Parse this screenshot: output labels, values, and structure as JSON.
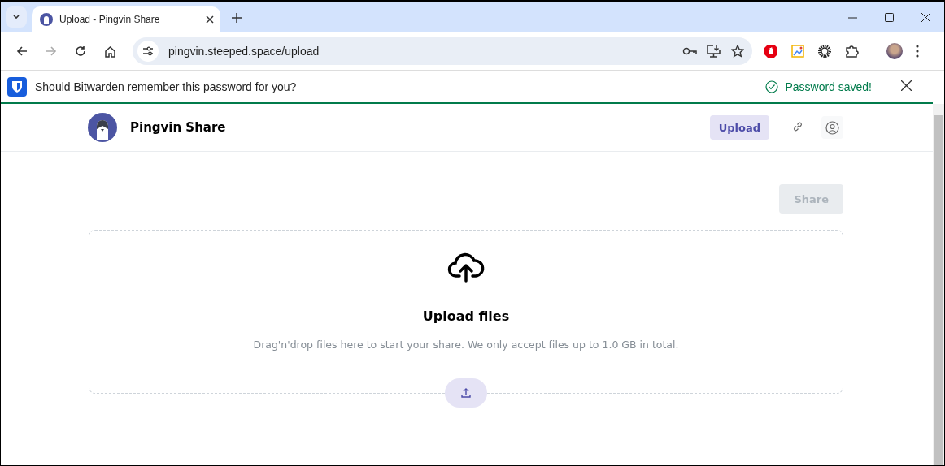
{
  "browser": {
    "tab": {
      "title": "Upload - Pingvin Share",
      "selected": true
    },
    "url": "pingvin.steeped.space/upload"
  },
  "bitwarden_bar": {
    "message": "Should Bitwarden remember this password for you?",
    "status": "Password saved!"
  },
  "header": {
    "app_name": "Pingvin Share",
    "nav_button": "Upload"
  },
  "share_button": {
    "label": "Share",
    "disabled": true
  },
  "dropzone": {
    "title": "Upload files",
    "description": "Drag'n'drop files here to start your share. We only accept files up to 1.0 GB in total."
  }
}
